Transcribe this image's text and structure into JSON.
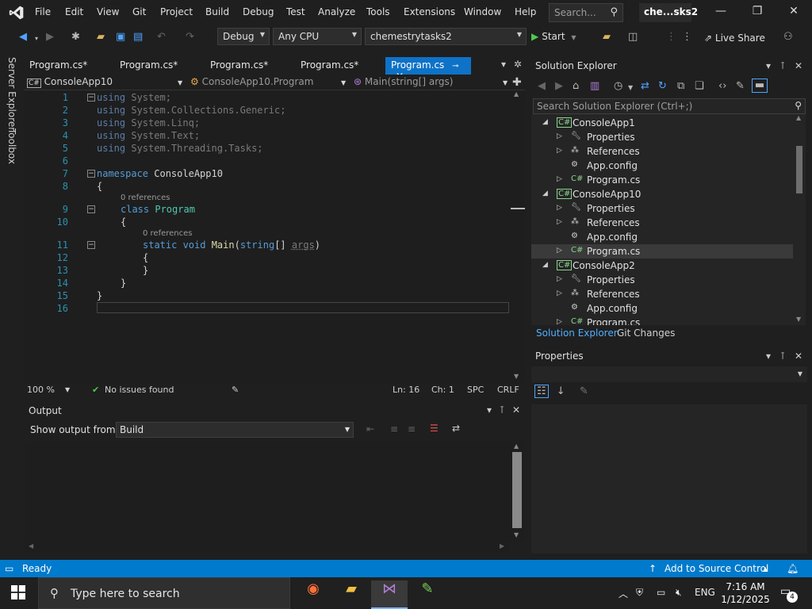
{
  "titlebar": {
    "menus": [
      "File",
      "Edit",
      "View",
      "Git",
      "Project",
      "Build",
      "Debug",
      "Test",
      "Analyze",
      "Tools",
      "Extensions",
      "Window",
      "Help"
    ],
    "search_placeholder": "Search...",
    "solution_title": "che...sks2"
  },
  "toolbar": {
    "config": "Debug",
    "platform": "Any CPU",
    "startup_project": "chemestrytasks2",
    "start_label": "Start",
    "liveshare_label": "Live Share"
  },
  "side": {
    "server_explorer": "Server Explorer",
    "toolbox": "Toolbox"
  },
  "tabs": [
    {
      "label": "Program.cs*"
    },
    {
      "label": "Program.cs*"
    },
    {
      "label": "Program.cs*"
    },
    {
      "label": "Program.cs*"
    },
    {
      "label": "Program.cs"
    }
  ],
  "navbar": {
    "project": "ConsoleApp10",
    "class": "ConsoleApp10.Program",
    "member": "Main(string[] args)"
  },
  "editor": {
    "line_numbers": [
      "1",
      "2",
      "3",
      "4",
      "5",
      "6",
      "7",
      "8",
      "9",
      "10",
      "11",
      "12",
      "13",
      "14",
      "15",
      "16"
    ],
    "code_line_1_kw": "using",
    "code_line_1": " System;",
    "code_line_2_kw": "using",
    "code_line_2": " System.Collections.Generic;",
    "code_line_3_kw": "using",
    "code_line_3": " System.Linq;",
    "code_line_4_kw": "using",
    "code_line_4": " System.Text;",
    "code_line_5_kw": "using",
    "code_line_5": " System.Threading.Tasks;",
    "code_line_7_kw": "namespace",
    "code_line_7": " ConsoleApp10",
    "brace_open": "{",
    "brace_close": "}",
    "refs_1": "0 references",
    "code_line_9_kw": "class",
    "code_line_9_ty": " Program",
    "refs_2": "0 references",
    "code_line_11_kw1": "static",
    "code_line_11_kw2": " void",
    "code_line_11_fn": " Main",
    "code_line_11_p1": "(",
    "code_line_11_kw3": "string",
    "code_line_11_p2": "[] ",
    "code_line_11_arg": "args",
    "code_line_11_p3": ")"
  },
  "editor_status": {
    "zoom": "100 %",
    "issues": "No issues found",
    "line": "Ln: 16",
    "col": "Ch: 1",
    "spc": "SPC",
    "eol": "CRLF"
  },
  "output": {
    "title": "Output",
    "show_from_label": "Show output from:",
    "source": "Build"
  },
  "solution_explorer": {
    "title": "Solution Explorer",
    "search_placeholder": "Search Solution Explorer (Ctrl+;)",
    "tree": [
      {
        "label": "ConsoleApp1",
        "kind": "project",
        "level": 0,
        "expanded": true
      },
      {
        "label": "Properties",
        "kind": "properties",
        "level": 1
      },
      {
        "label": "References",
        "kind": "references",
        "level": 1
      },
      {
        "label": "App.config",
        "kind": "config",
        "level": 1
      },
      {
        "label": "Program.cs",
        "kind": "cs",
        "level": 1
      },
      {
        "label": "ConsoleApp10",
        "kind": "project",
        "level": 0,
        "expanded": true
      },
      {
        "label": "Properties",
        "kind": "properties",
        "level": 1
      },
      {
        "label": "References",
        "kind": "references",
        "level": 1
      },
      {
        "label": "App.config",
        "kind": "config",
        "level": 1
      },
      {
        "label": "Program.cs",
        "kind": "cs",
        "level": 1,
        "selected": true
      },
      {
        "label": "ConsoleApp2",
        "kind": "project",
        "level": 0,
        "expanded": true
      },
      {
        "label": "Properties",
        "kind": "properties",
        "level": 1
      },
      {
        "label": "References",
        "kind": "references",
        "level": 1
      },
      {
        "label": "App.config",
        "kind": "config",
        "level": 1
      },
      {
        "label": "Program.cs",
        "kind": "cs",
        "level": 1
      }
    ],
    "bottom_tabs": [
      "Solution Explorer",
      "Git Changes"
    ]
  },
  "properties": {
    "title": "Properties"
  },
  "statusbar": {
    "ready": "Ready",
    "source_control": "Add to Source Control"
  },
  "taskbar": {
    "search_placeholder": "Type here to search",
    "lang": "ENG",
    "time": "7:16 AM",
    "date": "1/12/2025",
    "notification_count": "4"
  },
  "colors": {
    "accent": "#007acc",
    "active_tab": "#0e72c7",
    "keyword": "#569cd6",
    "type": "#4ec9b0",
    "line_number": "#2b91af"
  }
}
